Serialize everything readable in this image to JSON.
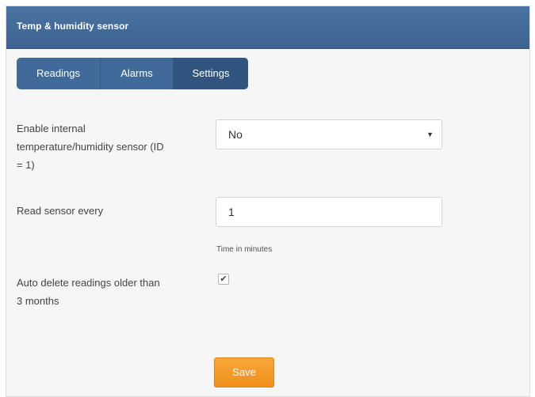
{
  "panel": {
    "title": "Temp & humidity sensor"
  },
  "tabs": [
    {
      "label": "Readings"
    },
    {
      "label": "Alarms"
    },
    {
      "label": "Settings",
      "active": true
    }
  ],
  "form": {
    "enable_sensor": {
      "label_line1": "Enable internal",
      "label_line2": "temperature/humidity sensor (ID",
      "label_line3": "= 1)",
      "value": "No"
    },
    "read_every": {
      "label": "Read sensor every",
      "value": "1",
      "help": "Time in minutes"
    },
    "auto_delete": {
      "label_line1": "Auto delete readings older than",
      "label_line2": "3 months",
      "checked": true
    },
    "save_label": "Save"
  },
  "colors": {
    "header": "#3f6a9a",
    "tab_active": "#30567f",
    "save_button": "#f39c28"
  },
  "icons": {
    "select_caret": "caret-down-icon",
    "checkbox_mark": "checkmark-icon"
  }
}
